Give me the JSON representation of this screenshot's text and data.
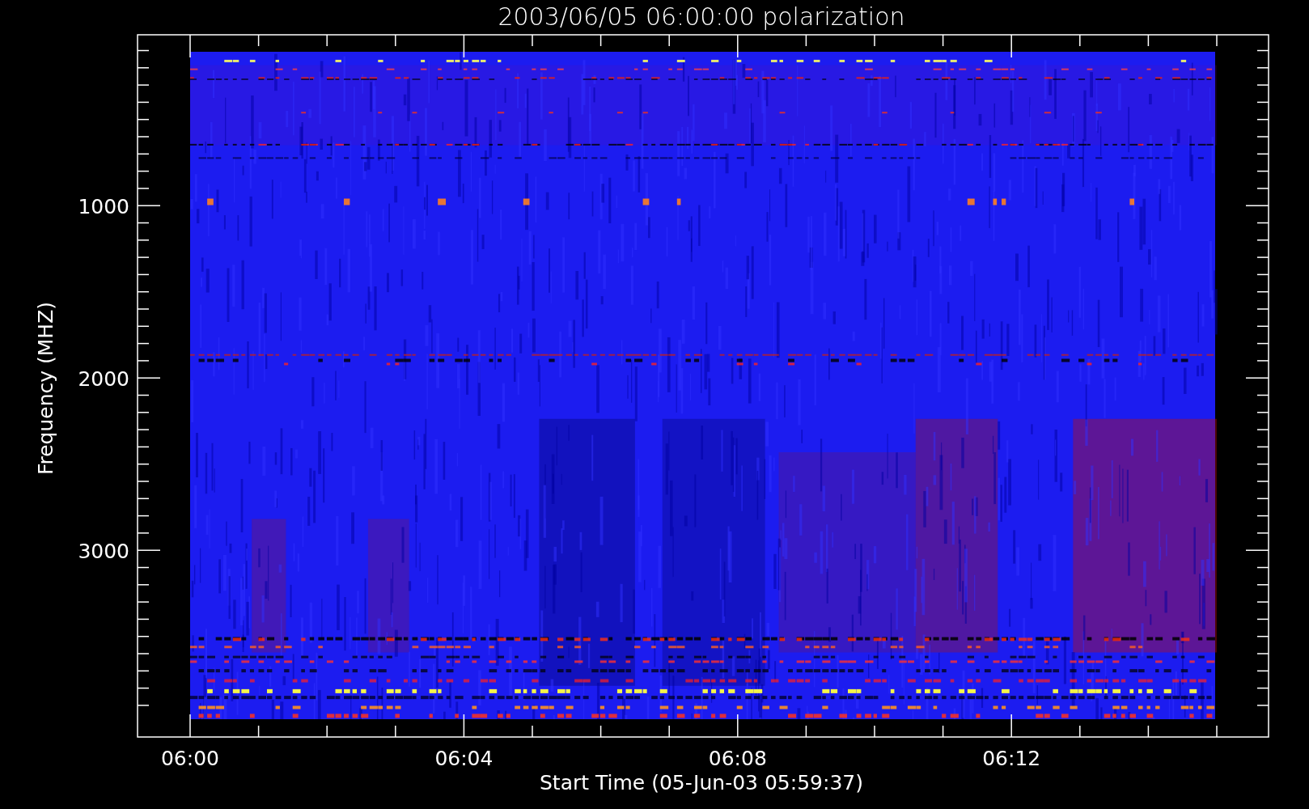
{
  "title": "2003/06/05 06:00:00 polarization",
  "y_axis": {
    "label": "Frequency (MHZ)",
    "tick_labels": [
      "1000",
      "2000",
      "3000"
    ]
  },
  "x_axis": {
    "label": "Start Time (05-Jun-03 05:59:37)",
    "tick_labels": [
      "06:00",
      "06:04",
      "06:08",
      "06:12"
    ]
  }
}
